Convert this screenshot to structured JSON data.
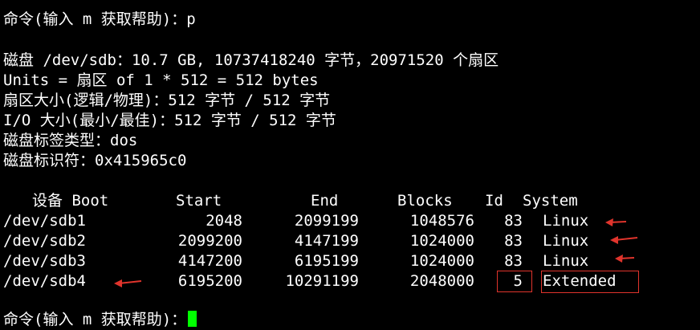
{
  "prompt_cmd_1": "命令(输入 m 获取帮助)：p",
  "disk_info": {
    "line_disk": "磁盘 /dev/sdb：10.7 GB, 10737418240 字节，20971520 个扇区",
    "line_units": "Units = 扇区 of 1 * 512 = 512 bytes",
    "line_sector_size": "扇区大小(逻辑/物理)：512 字节 / 512 字节",
    "line_io_size": "I/O 大小(最小/最佳)：512 字节 / 512 字节",
    "line_label_type": "磁盘标签类型：dos",
    "line_identifier": "磁盘标识符：0x415965c0"
  },
  "partition_table": {
    "headers": {
      "device_boot": "设备 Boot",
      "start": "Start",
      "end": "End",
      "blocks": "Blocks",
      "id": "Id",
      "system": "System"
    },
    "rows": [
      {
        "device": "/dev/sdb1",
        "start": "2048",
        "end": "2099199",
        "blocks": "1048576",
        "id": "83",
        "system": "Linux"
      },
      {
        "device": "/dev/sdb2",
        "start": "2099200",
        "end": "4147199",
        "blocks": "1024000",
        "id": "83",
        "system": "Linux"
      },
      {
        "device": "/dev/sdb3",
        "start": "4147200",
        "end": "6195199",
        "blocks": "1024000",
        "id": "83",
        "system": "Linux"
      },
      {
        "device": "/dev/sdb4",
        "start": "6195200",
        "end": "10291199",
        "blocks": "2048000",
        "id": "5",
        "system": "Extended"
      }
    ]
  },
  "prompt_cmd_2": "命令(输入 m 获取帮助)：",
  "colors": {
    "background": "#000000",
    "text": "#ffffff",
    "cursor": "#00ff00",
    "annotation": "#e0342c"
  },
  "icons": {
    "cursor": "block-cursor",
    "annotation_arrows": "red-arrow-icon"
  }
}
